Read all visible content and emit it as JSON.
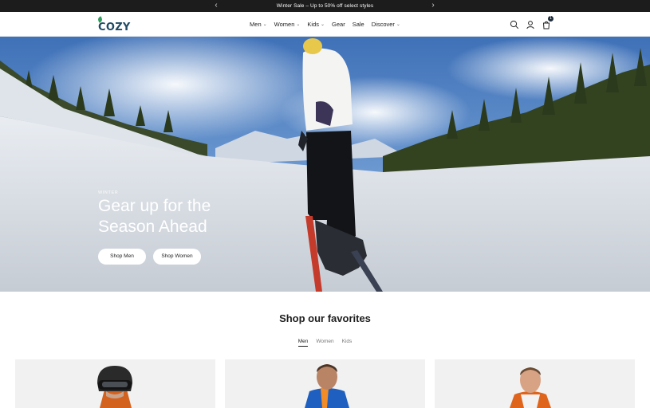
{
  "announcement": {
    "message": "Winter Sale – Up to 50% off select styles",
    "prev": "‹",
    "next": "›"
  },
  "header": {
    "logo": "COZY",
    "nav": [
      {
        "label": "Men",
        "has_dropdown": true
      },
      {
        "label": "Women",
        "has_dropdown": true
      },
      {
        "label": "Kids",
        "has_dropdown": true
      },
      {
        "label": "Gear",
        "has_dropdown": false
      },
      {
        "label": "Sale",
        "has_dropdown": false
      },
      {
        "label": "Discover",
        "has_dropdown": true
      }
    ],
    "dropdown_glyph": "⌄",
    "icons": [
      "search-icon",
      "account-icon",
      "cart-icon"
    ],
    "cart_count": "1"
  },
  "hero": {
    "kicker": "WINTER",
    "headline": "Gear up for the Season Ahead",
    "buttons": {
      "men": "Shop Men",
      "women": "Shop Women"
    }
  },
  "favorites": {
    "title": "Shop our favorites",
    "tabs": [
      "Men",
      "Women",
      "Kids"
    ],
    "active_tab": "Men"
  },
  "colors": {
    "announcement_bg": "#1c1c1c",
    "logo": "#1e4a63",
    "accent_green": "#2f9e5b",
    "card_bg": "#f1f1f1"
  }
}
